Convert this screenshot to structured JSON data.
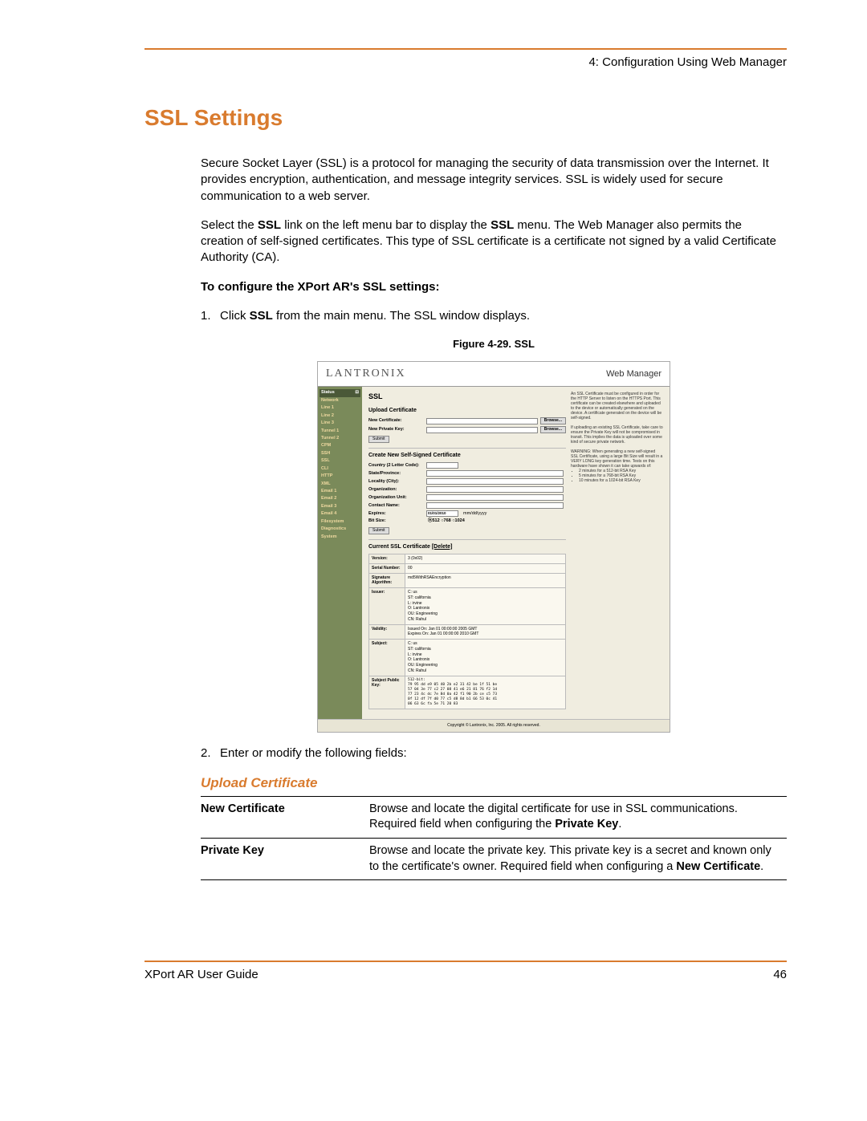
{
  "header": {
    "breadcrumb": "4: Configuration Using Web Manager"
  },
  "title": "SSL Settings",
  "p1": "Secure Socket Layer (SSL) is a protocol for managing the security of data transmission over the Internet.  It provides encryption, authentication, and message integrity services.  SSL is widely used for secure communication to a web server.",
  "p2a": "Select the ",
  "p2b": "SSL",
  "p2c": " link on the left menu bar to display the ",
  "p2d": "SSL",
  "p2e": " menu.  The Web Manager also permits the creation of self-signed certificates.  This type of SSL certificate is a certificate not signed by a valid Certificate Authority (CA).",
  "instr_heading": "To configure the XPort AR's SSL settings:",
  "step1_num": "1.",
  "step1a": "Click ",
  "step1b": "SSL",
  "step1c": " from the main menu. The SSL window displays.",
  "figure_caption": "Figure 4-29. SSL",
  "screenshot": {
    "logo": "LANTRONIX",
    "wm": "Web Manager",
    "sidebar_header": "Status",
    "sidebar_icon": "⊟",
    "sidebar": [
      "Network",
      "Line 1",
      "Line 2",
      "Line 3",
      "Tunnel 1",
      "Tunnel 2",
      "CPM",
      "SSH",
      "SSL",
      "CLI",
      "HTTP",
      "XML",
      "Email 1",
      "Email 2",
      "Email 3",
      "Email 4",
      "Filesystem",
      "Diagnostics",
      "System"
    ],
    "main_title": "SSL",
    "upload_title": "Upload Certificate",
    "new_cert": "New Certificate:",
    "new_pk": "New Private Key:",
    "browse": "Browse...",
    "submit": "Submit",
    "create_title": "Create New Self-Signed Certificate",
    "fields": {
      "country": "Country (2 Letter Code):",
      "state": "State/Province:",
      "locality": "Locality (City):",
      "org": "Organization:",
      "ou": "Organization Unit:",
      "cn": "Contact Name:",
      "expires": "Expires:",
      "expires_val": "01/01/2010",
      "expires_hint": "mm/dd/yyyy",
      "bitsize": "Bit Size:",
      "bits": "⦿512 ○768 ○1024"
    },
    "current_title": "Current SSL Certificate ",
    "delete": "[Delete]",
    "cert": {
      "version_k": "Version:",
      "version_v": "3 (0x02)",
      "serial_k": "Serial Number:",
      "serial_v": "00",
      "sig_k": "Signature Algorithm:",
      "sig_v": "md5WithRSAEncryption",
      "issuer_k": "Issuer:",
      "issuer_v": "C: us\nST: california\nL: irvine\nO: Lantronix\nOU: Engineering\nCN: Rahul",
      "validity_k": "Validity:",
      "validity_v": "Issued On: Jan 01 00:00:00 2005 GMT\nExpires On: Jan 01 00:00:00 2010 GMT",
      "subject_k": "Subject:",
      "subject_v": "C: us\nST: california\nL: irvine\nO: Lantronix\nOU: Engineering\nCN: Rahul",
      "pubkey_k": "Subject Public Key:",
      "pubkey_v": "512-bit:\n79 95 dd e9 05 40 2b e2 31 42 be 1f 51 be\n57 04 3e 77 c2 27 08 41 e6 21 81 76 f2 1d\n77 23 4c dc 7e 8d 0a 42 f1 90 2b ce c5 73\n0f 12 df 7f d0 77 c5 d8 8d b1 66 53 0c 41\n06 63 6c fa 5e 71 20 83"
    },
    "help_p1": "An SSL Certificate must be configured in order for the HTTP Server to listen on the HTTPS Port. This certificate can be created elsewhere and uploaded to the device or automatically generated on the device. A certificate generated on the device will be self-signed.",
    "help_p2": "If uploading an existing SSL Certificate, take care to ensure the Private Key will not be compromised in transit. This implies the data is uploaded over some kind of secure private network.",
    "help_warn": "WARNING: When generating a new self-signed SSL Certificate, using a large Bit Size will result in a VERY LONG key generation time. Tests on this hardware have shown it can take upwards of:",
    "help_times": [
      "2 minutes for a 512-bit RSA Key",
      "5 minutes for a 768-bit RSA Key",
      "10 minutes for a 1024-bit RSA Key"
    ],
    "copyright": "Copyright © Lantronix, Inc. 2005. All rights reserved."
  },
  "step2_num": "2.",
  "step2": "Enter or modify the following fields:",
  "upload_section": "Upload Certificate",
  "table": {
    "r1_k": "New Certificate",
    "r1_a": "Browse and locate the digital certificate for use in SSL communications.  Required field when configuring the ",
    "r1_b": "Private Key",
    "r1_c": ".",
    "r2_k": "Private Key",
    "r2_a": "Browse and locate the private key.  This private key is a secret and known only to the certificate's owner.  Required field when configuring a ",
    "r2_b": "New Certificate",
    "r2_c": "."
  },
  "footer": {
    "left": "XPort AR User Guide",
    "right": "46"
  }
}
